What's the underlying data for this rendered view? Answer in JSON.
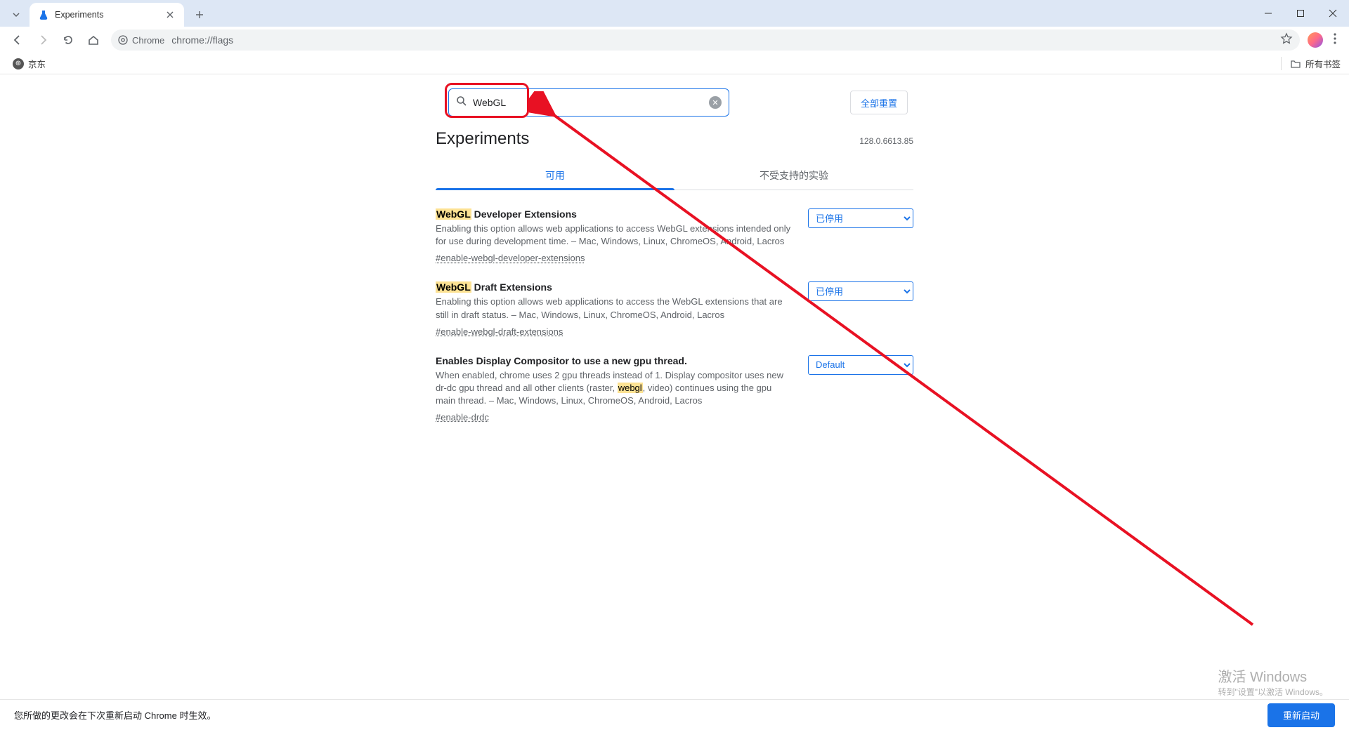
{
  "browser": {
    "tab_title": "Experiments",
    "url_label": "Chrome",
    "url": "chrome://flags",
    "bookmark": "京东",
    "all_bookmarks": "所有书签"
  },
  "search": {
    "value": "WebGL",
    "reset_all": "全部重置"
  },
  "header": {
    "title": "Experiments",
    "version": "128.0.6613.85"
  },
  "tabs": {
    "available": "可用",
    "unsupported": "不受支持的实验"
  },
  "flags": [
    {
      "title_hl": "WebGL",
      "title_rest": " Developer Extensions",
      "desc": "Enabling this option allows web applications to access WebGL extensions intended only for use during development time. – Mac, Windows, Linux, ChromeOS, Android, Lacros",
      "hash": "#enable-webgl-developer-extensions",
      "state": "已停用"
    },
    {
      "title_hl": "WebGL",
      "title_rest": " Draft Extensions",
      "desc": "Enabling this option allows web applications to access the WebGL extensions that are still in draft status. – Mac, Windows, Linux, ChromeOS, Android, Lacros",
      "hash": "#enable-webgl-draft-extensions",
      "state": "已停用"
    },
    {
      "title_plain": "Enables Display Compositor to use a new gpu thread.",
      "desc_pre": "When enabled, chrome uses 2 gpu threads instead of 1. Display compositor uses new dr-dc gpu thread and all other clients (raster, ",
      "desc_hl": "webgl",
      "desc_post": ", video) continues using the gpu main thread. – Mac, Windows, Linux, ChromeOS, Android, Lacros",
      "hash": "#enable-drdc",
      "state": "Default"
    }
  ],
  "bottom": {
    "notice": "您所做的更改会在下次重新启动 Chrome 时生效。",
    "restart": "重新启动"
  },
  "watermark": {
    "line1": "激活 Windows",
    "line2": "转到\"设置\"以激活 Windows。"
  }
}
